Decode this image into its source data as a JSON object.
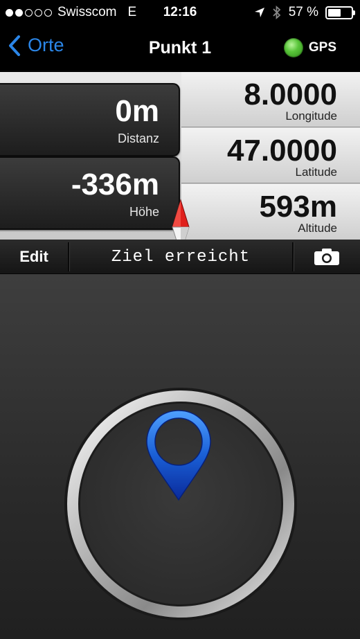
{
  "status_bar": {
    "carrier": "Swisscom",
    "network": "E",
    "time": "12:16",
    "battery_percent": "57 %",
    "battery_level": 0.57,
    "signal_dots_filled": 2,
    "signal_dots_total": 5
  },
  "nav": {
    "back_label": "Orte",
    "title": "Punkt 1",
    "gps_label": "GPS",
    "gps_status_color": "#4cbf2f"
  },
  "left_cards": {
    "distance": {
      "value": "0m",
      "label": "Distanz"
    },
    "height": {
      "value": "-336m",
      "label": "Höhe"
    }
  },
  "coordinates": {
    "longitude": {
      "value": "8.0000",
      "label": "Longitude"
    },
    "latitude": {
      "value": "47.0000",
      "label": "Latitude"
    },
    "altitude": {
      "value": "593m",
      "label": "Altitude"
    }
  },
  "toolbar": {
    "edit_label": "Edit",
    "status_message": "Ziel erreicht",
    "camera_icon": "camera-icon"
  },
  "colors": {
    "accent_blue": "#2b86e8",
    "needle_red": "#e0201c",
    "pin_blue": "#1a5fd6"
  }
}
